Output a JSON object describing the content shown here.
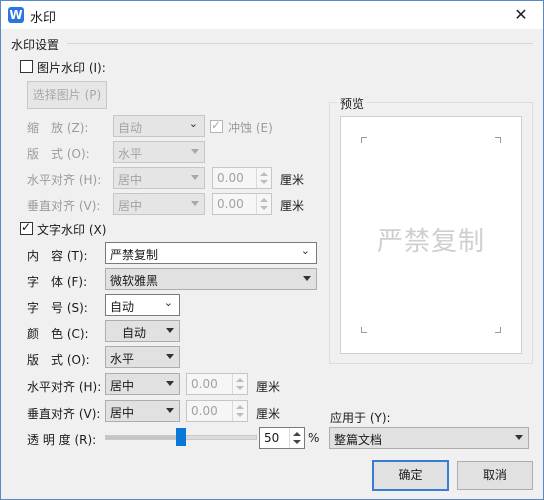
{
  "title": "水印",
  "close_glyph": "✕",
  "group_title": "水印设置",
  "picture": {
    "checkbox_label": "图片水印 (I):",
    "checked": false,
    "select_image_button": "选择图片 (P)",
    "scale_label": "缩　放 (Z):",
    "scale_value": "自动",
    "washout_label": "冲蚀 (E)",
    "washout_checked": true,
    "layout_label": "版　式 (O):",
    "layout_value": "水平",
    "halign_label": "水平对齐 (H):",
    "halign_value": "居中",
    "halign_offset": "0.00",
    "valign_label": "垂直对齐 (V):",
    "valign_value": "居中",
    "valign_offset": "0.00",
    "unit": "厘米"
  },
  "text": {
    "checkbox_label": "文字水印 (X)",
    "checked": true,
    "content_label": "内　容 (T):",
    "content_value": "严禁复制",
    "font_label": "字　体 (F):",
    "font_value": "微软雅黑",
    "size_label": "字　号 (S):",
    "size_value": "自动",
    "color_label": "颜　色 (C):",
    "color_value": "自动",
    "layout_label": "版　式 (O):",
    "layout_value": "水平",
    "halign_label": "水平对齐 (H):",
    "halign_value": "居中",
    "halign_offset": "0.00",
    "valign_label": "垂直对齐 (V):",
    "valign_value": "居中",
    "valign_offset": "0.00",
    "unit": "厘米",
    "transparency_label": "透 明 度 (R):",
    "transparency_value": "50",
    "transparency_unit": "%",
    "transparency_fraction": 0.5
  },
  "preview": {
    "title": "预览",
    "watermark_text": "严禁复制"
  },
  "apply_to": {
    "label": "应用于 (Y):",
    "value": "整篇文档"
  },
  "buttons": {
    "ok": "确定",
    "cancel": "取消"
  },
  "colors": {
    "accent": "#0a78d7",
    "logo": "#2b74e2"
  }
}
